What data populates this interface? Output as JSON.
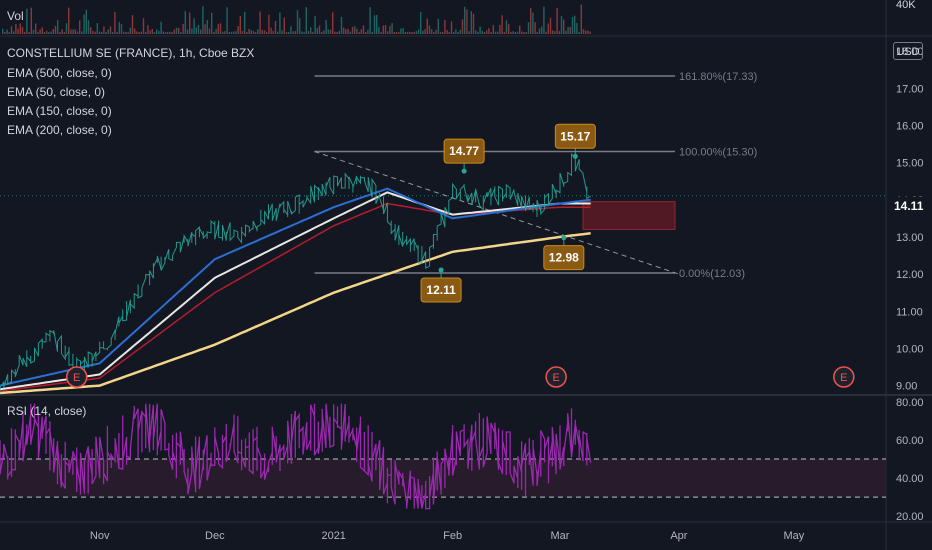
{
  "header": {
    "vol_label": "Vol",
    "symbol_line": "CONSTELLIUM SE (FRANCE), 1h, Cboe BZX",
    "indicators": [
      "EMA (500, close, 0)",
      "EMA (50, close, 0)",
      "EMA (150, close, 0)",
      "EMA (200, close, 0)"
    ],
    "currency_button": "USD",
    "rsi_label": "RSI (14, close)",
    "last_price": "14.11"
  },
  "colors": {
    "background": "#131722",
    "up": "#26a69a",
    "down": "#ef5350",
    "ema_blue": "#2a6fd1",
    "ema_white": "#e8e6e0",
    "ema_red": "#b71c2b",
    "ema_yellow": "#f3d58a",
    "rsi": "#9c27b0",
    "callout": "#8a5a12"
  },
  "chart_data": [
    {
      "type": "line",
      "title": "",
      "x_tick_labels": [
        "Nov",
        "Dec",
        "2021",
        "Feb",
        "Mar",
        "Apr",
        "May"
      ],
      "x_tick_dates": [
        "2020-11-01",
        "2020-12-01",
        "2021-01-01",
        "2021-02-01",
        "2021-03-01",
        "2021-04-01",
        "2021-05-01"
      ],
      "x_range": [
        "2020-10-06",
        "2021-05-25"
      ],
      "y_tick_labels": [
        "9.00",
        "10.00",
        "11.00",
        "12.00",
        "13.00",
        "14.00",
        "15.00",
        "16.00",
        "17.00",
        "18.00"
      ],
      "ylim": [
        8.8,
        18.3
      ],
      "vol_axis_label": "40K",
      "series": [
        {
          "name": "Price",
          "x": [
            "2020-10-06",
            "2020-10-13",
            "2020-10-20",
            "2020-10-27",
            "2020-11-03",
            "2020-11-10",
            "2020-11-17",
            "2020-11-24",
            "2020-12-01",
            "2020-12-08",
            "2020-12-15",
            "2020-12-22",
            "2020-12-29",
            "2021-01-05",
            "2021-01-12",
            "2021-01-19",
            "2021-01-26",
            "2021-02-02",
            "2021-02-09",
            "2021-02-16",
            "2021-02-23",
            "2021-03-02",
            "2021-03-05",
            "2021-03-09"
          ],
          "values": [
            9.0,
            9.7,
            10.3,
            9.5,
            10.1,
            11.3,
            12.3,
            12.9,
            13.2,
            13.1,
            13.6,
            13.8,
            14.3,
            14.5,
            14.3,
            12.9,
            12.4,
            14.3,
            14.0,
            14.2,
            13.7,
            14.5,
            15.1,
            14.1
          ]
        },
        {
          "x": [
            "2020-10-06",
            "2020-11-01",
            "2020-12-01",
            "2021-01-01",
            "2021-01-15",
            "2021-02-01",
            "2021-03-01",
            "2021-03-09"
          ],
          "values": [
            9.0,
            9.6,
            12.4,
            13.8,
            14.3,
            13.5,
            13.9,
            14.0
          ]
        },
        {
          "x": [
            "2020-10-06",
            "2020-11-01",
            "2020-12-01",
            "2021-01-01",
            "2021-01-15",
            "2021-02-01",
            "2021-03-01",
            "2021-03-09"
          ],
          "values": [
            8.9,
            9.3,
            11.9,
            13.5,
            14.2,
            13.6,
            13.9,
            13.9
          ]
        },
        {
          "x": [
            "2020-10-06",
            "2020-11-01",
            "2020-12-01",
            "2021-01-01",
            "2021-01-15",
            "2021-02-01",
            "2021-03-01",
            "2021-03-09"
          ],
          "values": [
            8.85,
            9.2,
            11.5,
            13.3,
            13.9,
            13.6,
            13.8,
            13.8
          ]
        },
        {
          "x": [
            "2020-10-06",
            "2020-11-01",
            "2020-12-01",
            "2021-01-01",
            "2021-02-01",
            "2021-03-01",
            "2021-03-09"
          ],
          "values": [
            8.8,
            9.0,
            10.1,
            11.5,
            12.6,
            13.0,
            13.1
          ]
        }
      ],
      "fibonacci": [
        {
          "label": "161.80%(17.33)",
          "value": 17.33
        },
        {
          "label": "100.00%(15.30)",
          "value": 15.3
        },
        {
          "label": "0.00%(12.03)",
          "value": 12.03
        }
      ],
      "trendline": {
        "from": {
          "x": "2020-12-27",
          "y": 15.3
        },
        "to": {
          "x": "2021-04-01",
          "y": 12.0
        }
      },
      "callouts": [
        {
          "text": "14.77",
          "x": "2021-02-04",
          "y": 14.77,
          "position": "above"
        },
        {
          "text": "15.17",
          "x": "2021-03-05",
          "y": 15.17,
          "position": "above"
        },
        {
          "text": "12.98",
          "x": "2021-03-02",
          "y": 12.98,
          "position": "below"
        },
        {
          "text": "12.11",
          "x": "2021-01-29",
          "y": 12.11,
          "position": "below"
        }
      ],
      "earnings_markers": [
        {
          "label": "E",
          "x": "2020-10-26"
        },
        {
          "label": "E",
          "x": "2021-02-28"
        },
        {
          "label": "E",
          "x": "2021-05-14"
        }
      ],
      "zone": {
        "x_from": "2021-03-07",
        "x_to": "2021-03-31",
        "y_from": 13.2,
        "y_to": 13.95
      }
    },
    {
      "type": "line",
      "title": "",
      "y_tick_labels": [
        "20.00",
        "40.00",
        "60.00",
        "80.00"
      ],
      "ylim": [
        18,
        82
      ],
      "band": [
        30,
        50
      ],
      "series": [
        {
          "x": [
            "2020-10-06",
            "2020-10-15",
            "2020-10-25",
            "2020-11-05",
            "2020-11-15",
            "2020-11-25",
            "2020-12-05",
            "2020-12-15",
            "2020-12-25",
            "2021-01-05",
            "2021-01-15",
            "2021-01-25",
            "2021-02-01",
            "2021-02-10",
            "2021-02-20",
            "2021-03-01",
            "2021-03-05",
            "2021-03-09"
          ],
          "values": [
            45,
            70,
            40,
            55,
            70,
            45,
            60,
            50,
            65,
            70,
            40,
            28,
            55,
            60,
            45,
            55,
            65,
            48
          ]
        }
      ]
    }
  ]
}
